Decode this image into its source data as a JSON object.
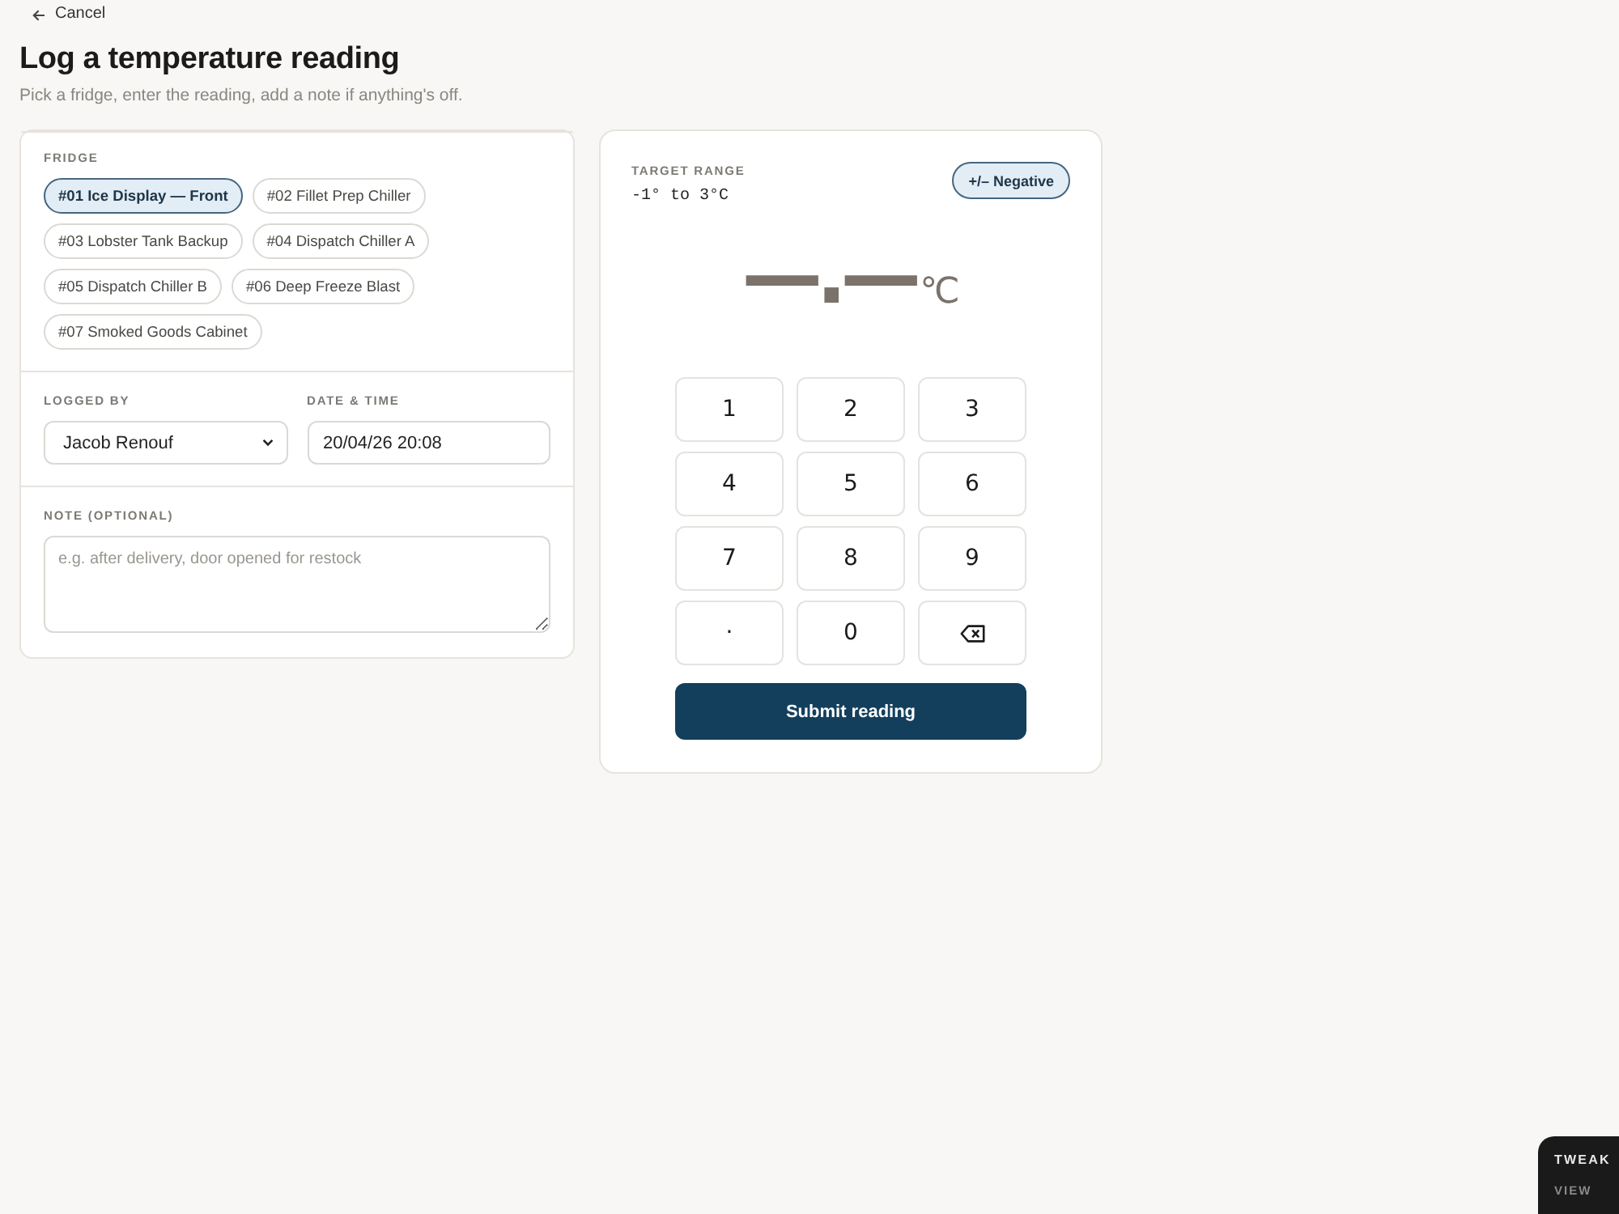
{
  "back_link": {
    "label": "Cancel"
  },
  "header": {
    "title": "Log a temperature reading",
    "subtitle": "Pick a fridge, enter the reading, add a note if anything's off."
  },
  "form": {
    "fridge": {
      "label": "FRIDGE",
      "options": [
        {
          "label": "#01 Ice Display — Front",
          "selected": true
        },
        {
          "label": "#02 Fillet Prep Chiller",
          "selected": false
        },
        {
          "label": "#03 Lobster Tank Backup",
          "selected": false
        },
        {
          "label": "#04 Dispatch Chiller A",
          "selected": false
        },
        {
          "label": "#05 Dispatch Chiller B",
          "selected": false
        },
        {
          "label": "#06 Deep Freeze Blast",
          "selected": false
        },
        {
          "label": "#07 Smoked Goods Cabinet",
          "selected": false
        }
      ]
    },
    "logged_by": {
      "label": "LOGGED BY",
      "value": "Jacob Renouf"
    },
    "date_time": {
      "label": "DATE & TIME",
      "value": "20/04/26 20:08"
    },
    "note": {
      "label": "NOTE (OPTIONAL)",
      "placeholder": "e.g. after delivery, door opened for restock"
    }
  },
  "reading": {
    "target_label": "TARGET RANGE",
    "target_value": "-1° to 3°C",
    "sign_button": "+/– Negative",
    "display": {
      "value": "—.—",
      "unit": "℃"
    },
    "keys": [
      {
        "kind": "digit",
        "label": "1"
      },
      {
        "kind": "digit",
        "label": "2"
      },
      {
        "kind": "digit",
        "label": "3"
      },
      {
        "kind": "digit",
        "label": "4"
      },
      {
        "kind": "digit",
        "label": "5"
      },
      {
        "kind": "digit",
        "label": "6"
      },
      {
        "kind": "digit",
        "label": "7"
      },
      {
        "kind": "digit",
        "label": "8"
      },
      {
        "kind": "digit",
        "label": "9"
      },
      {
        "kind": "decimal",
        "label": "."
      },
      {
        "kind": "digit",
        "label": "0"
      },
      {
        "kind": "backspace"
      }
    ],
    "submit": "Submit reading"
  },
  "tweaks_panel": {
    "title": "TWEAK",
    "section": "VIEW"
  }
}
